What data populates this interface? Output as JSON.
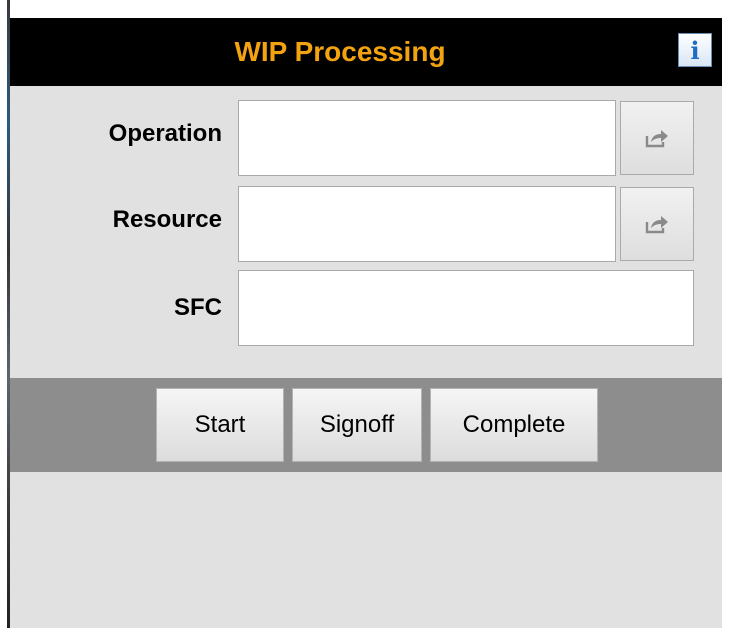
{
  "header": {
    "title": "WIP Processing",
    "info_icon": "info-icon",
    "info_glyph": "i",
    "title_color": "#f2a30f"
  },
  "form": {
    "operation": {
      "label": "Operation",
      "value": "",
      "browse_icon": "share-arrow-icon"
    },
    "resource": {
      "label": "Resource",
      "value": "",
      "browse_icon": "share-arrow-icon"
    },
    "sfc": {
      "label": "SFC",
      "value": ""
    }
  },
  "actions": {
    "start_label": "Start",
    "signoff_label": "Signoff",
    "complete_label": "Complete"
  }
}
